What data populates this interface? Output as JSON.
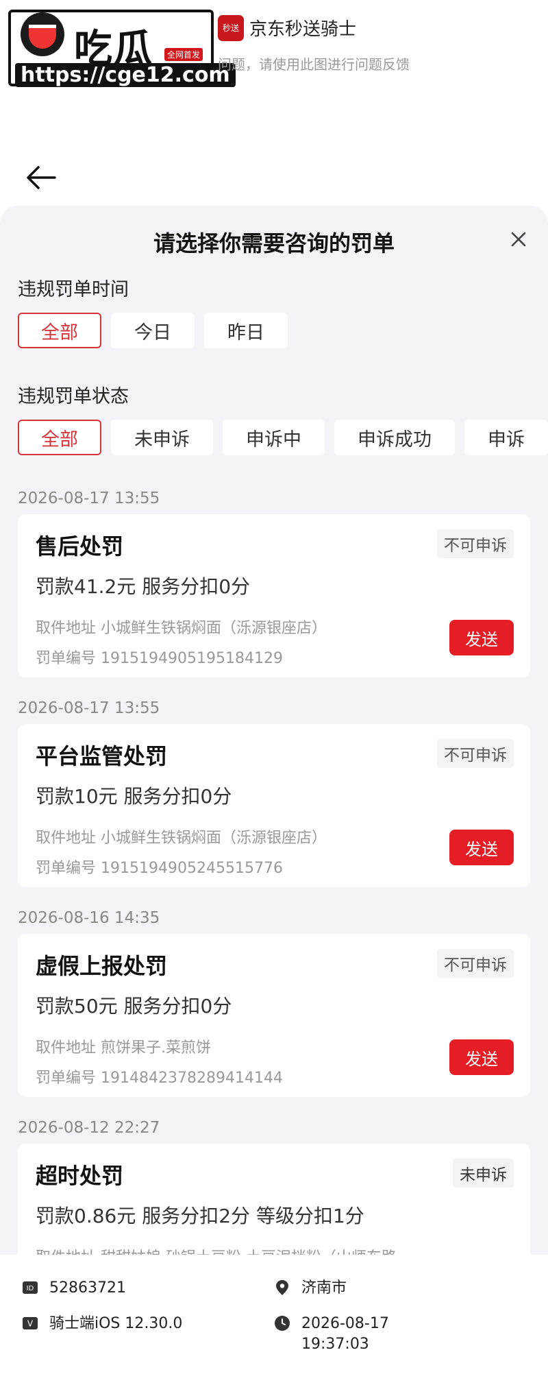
{
  "watermark": {
    "title": "吃瓜",
    "tag": "全网首发",
    "url": "https://cge12.com"
  },
  "app": {
    "icon_text": "秒送",
    "name": "京东秒送骑士",
    "subtitle": "问题，请使用此图进行问题反馈"
  },
  "sheet": {
    "title": "请选择你需要咨询的罚单",
    "time_label": "违规罚单时间",
    "time_chips": [
      "全部",
      "今日",
      "昨日"
    ],
    "status_label": "违规罚单状态",
    "status_chips": [
      "全部",
      "未申诉",
      "申诉中",
      "申诉成功",
      "申诉"
    ]
  },
  "records": [
    {
      "date": "2026-08-17 13:55",
      "title": "售后处罚",
      "badge": "不可申诉",
      "fine": "罚款41.2元  服务分扣0分",
      "address": "取件地址 小城鲜生铁锅焖面（泺源银座店）",
      "number": "罚单编号 1915194905195184129",
      "button": "发送"
    },
    {
      "date": "2026-08-17 13:55",
      "title": "平台监管处罚",
      "badge": "不可申诉",
      "fine": "罚款10元  服务分扣0分",
      "address": "取件地址 小城鲜生铁锅焖面（泺源银座店）",
      "number": "罚单编号 1915194905245515776",
      "button": "发送"
    },
    {
      "date": "2026-08-16 14:35",
      "title": "虚假上报处罚",
      "badge": "不可申诉",
      "fine": "罚款50元  服务分扣0分",
      "address": "取件地址 煎饼果子.菜煎饼",
      "number": "罚单编号 1914842378289414144",
      "button": "发送"
    },
    {
      "date": "2026-08-12 22:27",
      "title": "超时处罚",
      "badge": "未申诉",
      "fine": "罚款0.86元  服务分扣2分  等级分扣1分",
      "address": "取件地址 甜甜姑娘·砂锅土豆粉·土豆泥拌粉（山师东路"
    }
  ],
  "footer": {
    "id": "52863721",
    "city": "济南市",
    "client": "骑士端iOS  12.30.0",
    "datetime_date": "2026-08-17",
    "datetime_time": "19:37:03"
  }
}
